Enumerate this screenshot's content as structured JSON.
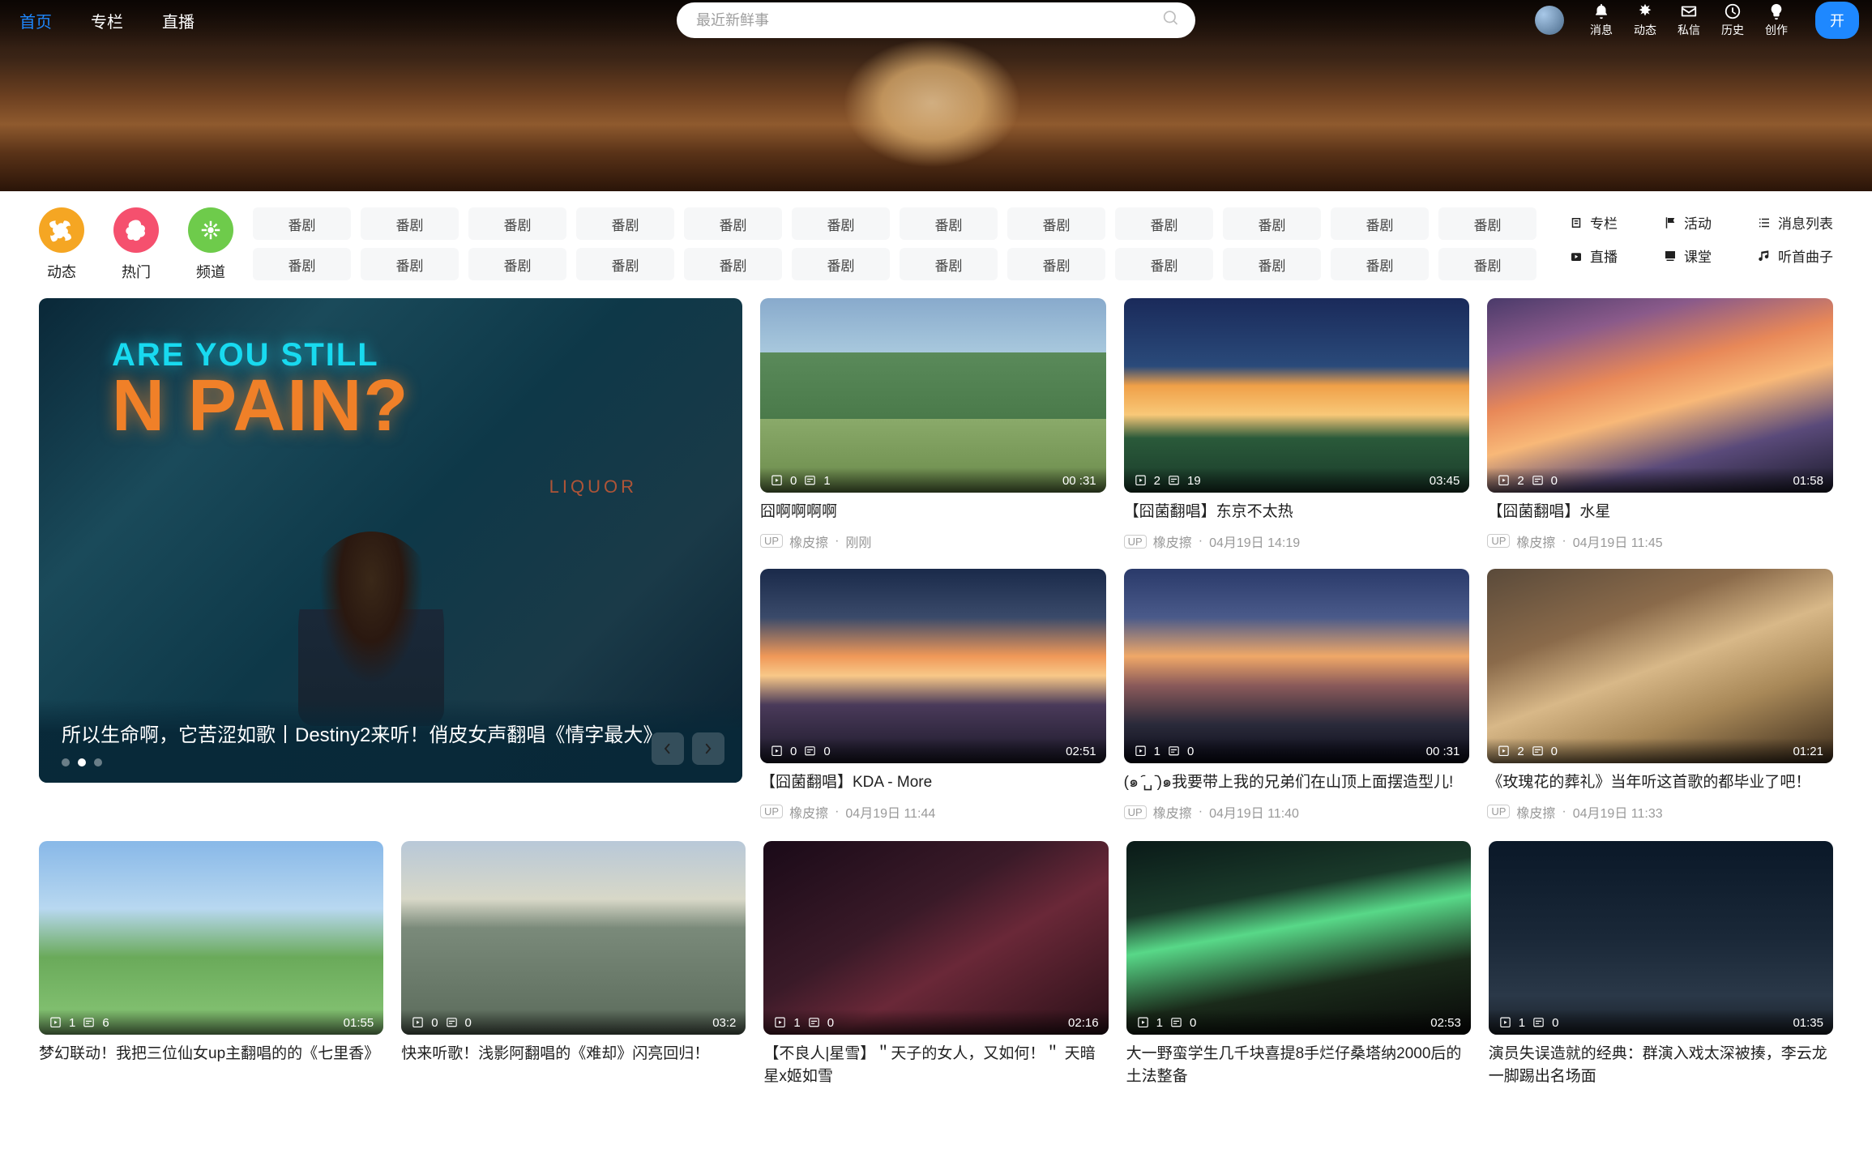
{
  "nav": {
    "home": "首页",
    "column": "专栏",
    "live": "直播"
  },
  "search": {
    "placeholder": "最近新鲜事"
  },
  "rightNav": [
    "消息",
    "动态",
    "私信",
    "历史",
    "创作"
  ],
  "createBtn": "开",
  "catIcons": {
    "items": [
      "动态",
      "热门",
      "频道"
    ],
    "colors": [
      "#f5a623",
      "#f5506e",
      "#6ecb4b"
    ]
  },
  "tags": [
    "番剧",
    "番剧",
    "番剧",
    "番剧",
    "番剧",
    "番剧",
    "番剧",
    "番剧",
    "番剧",
    "番剧",
    "番剧",
    "番剧",
    "番剧",
    "番剧",
    "番剧",
    "番剧",
    "番剧",
    "番剧",
    "番剧",
    "番剧",
    "番剧",
    "番剧",
    "番剧",
    "番剧"
  ],
  "sideLinks": [
    "专栏",
    "活动",
    "消息列表",
    "直播",
    "课堂",
    "听首曲子"
  ],
  "hero": {
    "sign1": "ARE YOU STILL",
    "sign2": "N PAIN?",
    "liquor": "LIQUOR",
    "title": "所以生命啊，它苦涩如歌丨Destiny2来听！俏皮女声翻唱《情字最大》"
  },
  "cards": [
    {
      "title": "囧啊啊啊啊",
      "plays": "0",
      "dm": "1",
      "dur": "00 :31",
      "up": "橡皮擦",
      "date": "刚刚",
      "tb": "tb1"
    },
    {
      "title": "【囧菌翻唱】东京不太热",
      "plays": "2",
      "dm": "19",
      "dur": "03:45",
      "up": "橡皮擦",
      "date": "04月19日 14:19",
      "tb": "tb2"
    },
    {
      "title": "【囧菌翻唱】水星",
      "plays": "2",
      "dm": "0",
      "dur": "01:58",
      "up": "橡皮擦",
      "date": "04月19日 11:45",
      "tb": "tb3"
    },
    {
      "title": "【囧菌翻唱】KDA - More",
      "plays": "0",
      "dm": "0",
      "dur": "02:51",
      "up": "橡皮擦",
      "date": "04月19日 11:44",
      "tb": "tb4"
    },
    {
      "title": "(๑ ᷇␣ ᷆)๑我要带上我的兄弟们在山顶上面摆造型儿!",
      "plays": "1",
      "dm": "0",
      "dur": "00 :31",
      "up": "橡皮擦",
      "date": "04月19日 11:40",
      "tb": "tb5"
    },
    {
      "title": "《玫瑰花的葬礼》当年听这首歌的都毕业了吧！",
      "plays": "2",
      "dm": "0",
      "dur": "01:21",
      "up": "橡皮擦",
      "date": "04月19日 11:33",
      "tb": "tb6"
    },
    {
      "title": "梦幻联动！我把三位仙女up主翻唱的的《七里香》",
      "plays": "1",
      "dm": "6",
      "dur": "01:55",
      "tb": "tb7"
    },
    {
      "title": "快来听歌！浅影阿翻唱的《难却》闪亮回归！",
      "plays": "0",
      "dm": "0",
      "dur": "03:2",
      "tb": "tb8"
    },
    {
      "title": "【不良人|星雪】＂天子的女人，又如何！＂ 天暗星x姬如雪",
      "plays": "1",
      "dm": "0",
      "dur": "02:16",
      "tb": "tb9"
    },
    {
      "title": "大一野蛮学生几千块喜提8手烂仔桑塔纳2000后的土法整备",
      "plays": "1",
      "dm": "0",
      "dur": "02:53",
      "tb": "tb10"
    },
    {
      "title": "演员失误造就的经典：群演入戏太深被揍，李云龙一脚踢出名场面",
      "plays": "1",
      "dm": "0",
      "dur": "01:35",
      "tb": "tb11"
    }
  ]
}
